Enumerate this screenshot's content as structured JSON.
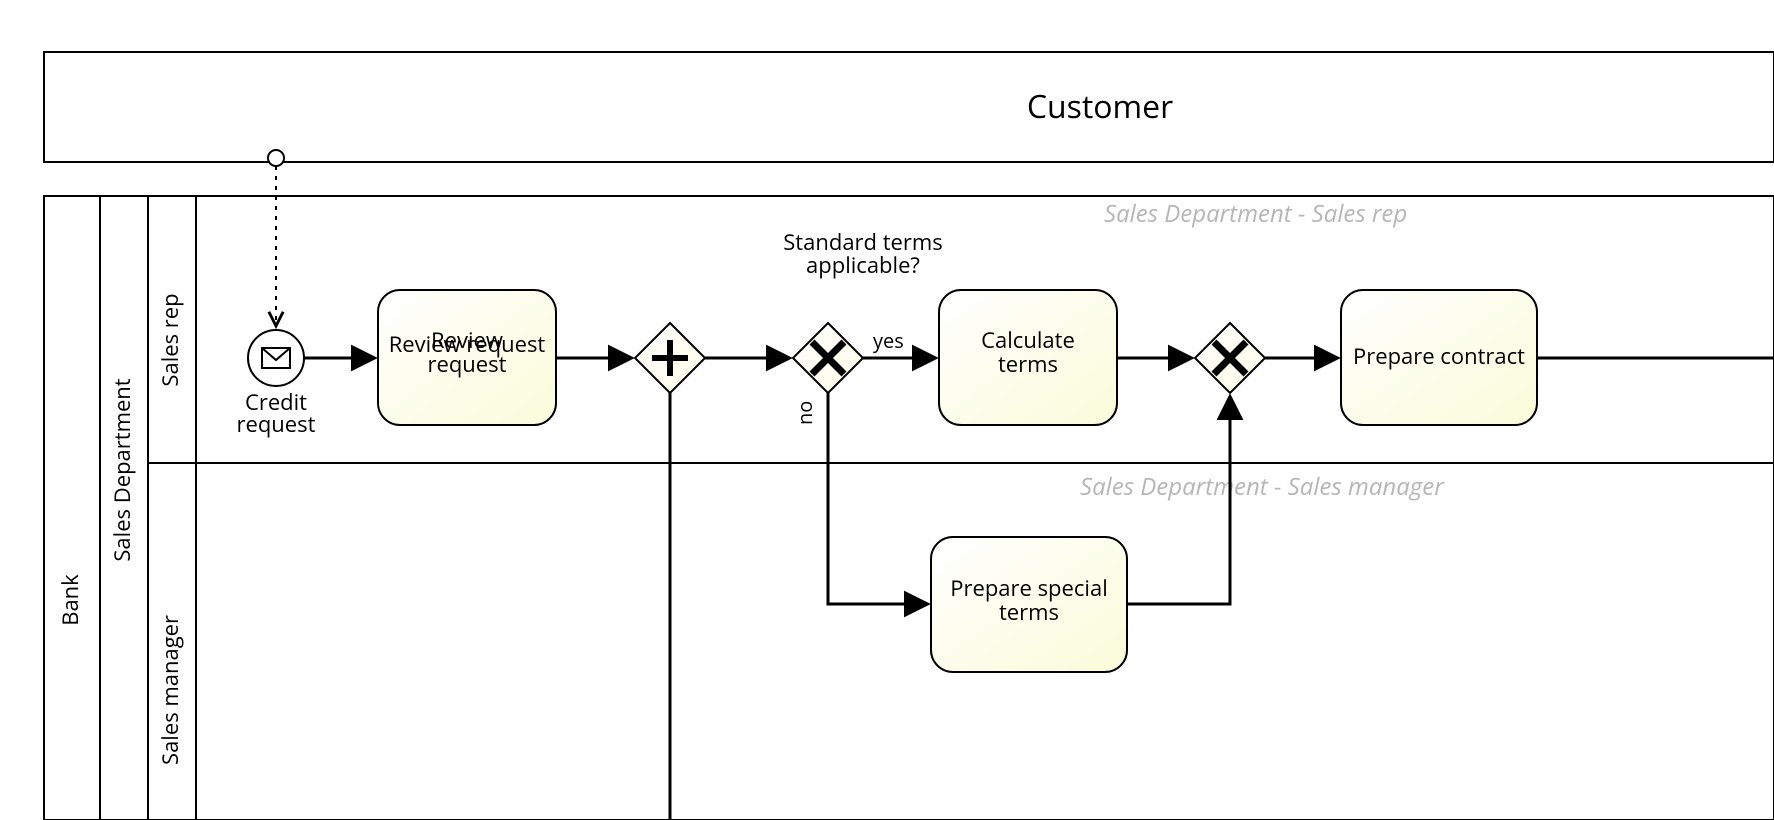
{
  "participants": {
    "customer": "Customer",
    "bank": "Bank",
    "salesDept": "Sales Department",
    "salesRep": "Sales rep",
    "salesMgr": "Sales manager"
  },
  "watermarks": {
    "rep": "Sales Department - Sales rep",
    "mgr": "Sales Department - Sales manager"
  },
  "startEvent": {
    "label": "Credit request"
  },
  "tasks": {
    "review": "Review request",
    "calc": "Calculate terms",
    "special": "Prepare special terms",
    "contract": "Prepare contract"
  },
  "gateways": {
    "stdTermsQuestion": "Standard terms applicable?",
    "yes": "yes",
    "no": "no"
  }
}
